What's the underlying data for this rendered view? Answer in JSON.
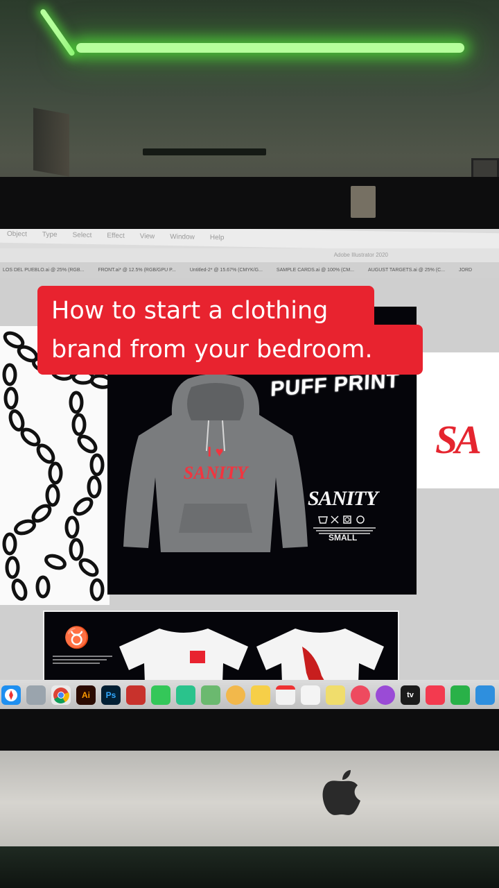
{
  "caption": {
    "line1": "How to start a clothing",
    "line2": "brand from your bedroom."
  },
  "screen": {
    "menubar": [
      "Object",
      "Type",
      "Select",
      "Effect",
      "View",
      "Window",
      "Help"
    ],
    "title": "Adobe Illustrator 2020",
    "doc_tabs": [
      "LOS DEL PUEBLO.ai @ 25% (RGB...",
      "FRONT.ai* @ 12.5% (RGB/GPU P...",
      "Untitled-2* @ 15.67% (CMYK/G...",
      "SAMPLE CARDS.ai @ 100% (CM...",
      "AUGUST TARGETS.ai @ 25% (C...",
      "JORD"
    ],
    "artwork": {
      "puff_print": "PUFF PRINT",
      "hoodie_print_line1": "I ♥",
      "hoodie_print_line2": "SANITY",
      "logo_text": "SANITY",
      "size_label": "SMALL",
      "right_logo": "SA"
    }
  },
  "dock": {
    "apps": [
      {
        "name": "Safari",
        "label": "",
        "color": "#1e8ff0"
      },
      {
        "name": "Preview",
        "label": "",
        "color": "#9aa4ad"
      },
      {
        "name": "Chrome",
        "label": "",
        "color": "#eaeaea"
      },
      {
        "name": "Illustrator",
        "label": "Ai",
        "color": "#2b0b01"
      },
      {
        "name": "Photoshop",
        "label": "Ps",
        "color": "#021f33"
      },
      {
        "name": "Photo Booth",
        "label": "",
        "color": "#c8322c"
      },
      {
        "name": "Messages",
        "label": "",
        "color": "#34c759"
      },
      {
        "name": "FaceTime",
        "label": "",
        "color": "#2ac38c"
      },
      {
        "name": "Maps",
        "label": "",
        "color": "#6bb96f"
      },
      {
        "name": "Photos",
        "label": "",
        "color": "#f2b84b"
      },
      {
        "name": "Notes",
        "label": "",
        "color": "#f6cf48"
      },
      {
        "name": "Calendar",
        "label": "",
        "color": "#f2f2f2"
      },
      {
        "name": "TextEdit",
        "label": "",
        "color": "#f4f4f4"
      },
      {
        "name": "Stickies",
        "label": "",
        "color": "#f0dd6c"
      },
      {
        "name": "Music",
        "label": "",
        "color": "#ee4a5f"
      },
      {
        "name": "Podcasts",
        "label": "",
        "color": "#9a4bd6"
      },
      {
        "name": "Apple TV",
        "label": "tv",
        "color": "#1b1b1b"
      },
      {
        "name": "News",
        "label": "",
        "color": "#f33a4f"
      },
      {
        "name": "Numbers",
        "label": "",
        "color": "#29b148"
      },
      {
        "name": "Keynote",
        "label": "",
        "color": "#2e8fde"
      }
    ]
  }
}
